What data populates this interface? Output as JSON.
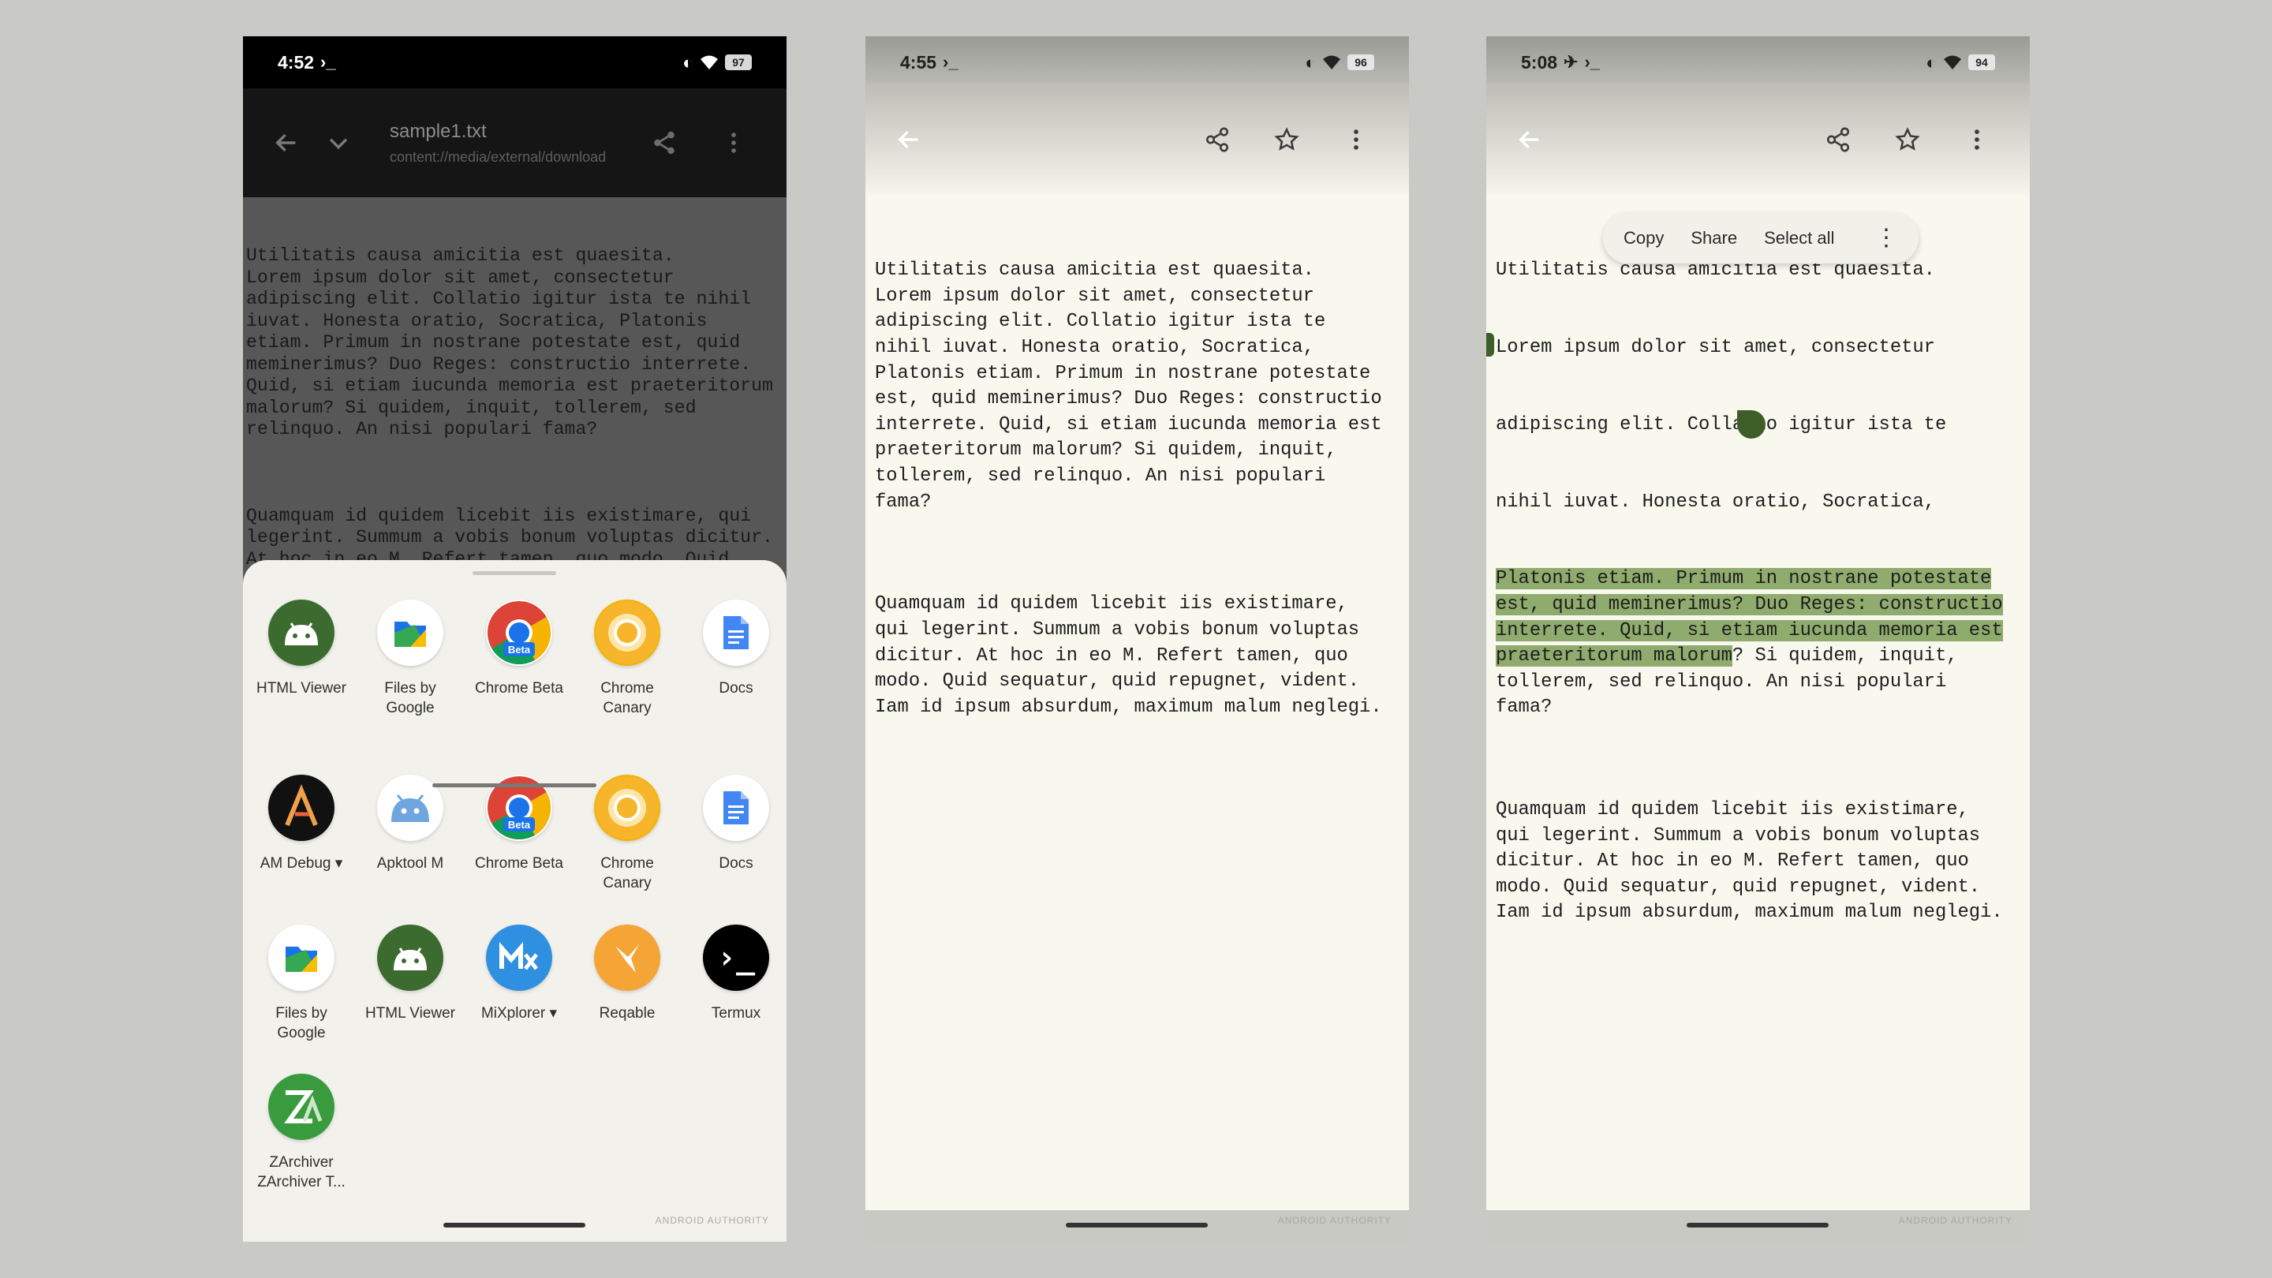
{
  "accent": "#8fab6d",
  "panel1": {
    "status": {
      "time": "4:52",
      "glyph": "›_",
      "battery": "97"
    },
    "toolbar": {
      "title": "sample1.txt",
      "subtitle": "content://media/external/download",
      "back_icon": "arrow-left",
      "dropdown_icon": "chevron-down",
      "share_icon": "share",
      "menu_icon": "more-vert"
    },
    "paragraph1": "Utilitatis causa amicitia est quaesita.\nLorem ipsum dolor sit amet, consectetur\nadipiscing elit. Collatio igitur ista te nihil\niuvat. Honesta oratio, Socratica, Platonis\netiam. Primum in nostrane potestate est, quid\nmeminerimus? Duo Reges: constructio interrete.\nQuid, si etiam iucunda memoria est praeteritorum\nmalorum? Si quidem, inquit, tollerem, sed\nrelinquo. An nisi populari fama?",
    "paragraph2": "Quamquam id quidem licebit iis existimare, qui\nlegerint. Summum a vobis bonum voluptas dicitur.\nAt hoc in eo M. Refert tamen, quo modo. Quid\nsequatur, quid repugnet, vident. Iam id ipsum\nabsurdum, maximum malum neglegi.",
    "apps": [
      {
        "label": "HTML Viewer",
        "icon": "android-icon"
      },
      {
        "label": "Files by\nGoogle",
        "icon": "files-icon"
      },
      {
        "label": "Chrome Beta",
        "icon": "chrome-beta-icon",
        "badge": "Beta"
      },
      {
        "label": "Chrome\nCanary",
        "icon": "chrome-canary-icon"
      },
      {
        "label": "Docs",
        "icon": "docs-icon"
      },
      {
        "label": "AM Debug ▾",
        "icon": "am-debug-icon",
        "glyph": "A"
      },
      {
        "label": "Apktool M",
        "icon": "apktool-icon"
      },
      {
        "label": "Chrome Beta",
        "icon": "chrome-beta-icon",
        "badge": "Beta"
      },
      {
        "label": "Chrome\nCanary",
        "icon": "chrome-canary-icon"
      },
      {
        "label": "Docs",
        "icon": "docs-icon"
      },
      {
        "label": "Files by\nGoogle",
        "icon": "files-icon"
      },
      {
        "label": "HTML Viewer",
        "icon": "android-icon"
      },
      {
        "label": "MiXplorer ▾",
        "icon": "mixplorer-icon"
      },
      {
        "label": "Reqable",
        "icon": "reqable-icon"
      },
      {
        "label": "Termux",
        "icon": "termux-icon",
        "glyph": "›_"
      },
      {
        "label": "ZArchiver\nZArchiver T...",
        "icon": "zarchiver-icon",
        "glyph": "ZA"
      }
    ]
  },
  "panel2": {
    "status": {
      "time": "4:55",
      "glyph": "›_",
      "battery": "96"
    },
    "paragraph1": "Utilitatis causa amicitia est quaesita.\nLorem ipsum dolor sit amet, consectetur\nadipiscing elit. Collatio igitur ista te\nnihil iuvat. Honesta oratio, Socratica,\nPlatonis etiam. Primum in nostrane potestate\nest, quid meminerimus? Duo Reges: constructio\ninterrete. Quid, si etiam iucunda memoria est\npraeteritorum malorum? Si quidem, inquit,\ntollerem, sed relinquo. An nisi populari\nfama?",
    "paragraph2": "Quamquam id quidem licebit iis existimare,\nqui legerint. Summum a vobis bonum voluptas\ndicitur. At hoc in eo M. Refert tamen, quo\nmodo. Quid sequatur, quid repugnet, vident.\nIam id ipsum absurdum, maximum malum neglegi."
  },
  "panel3": {
    "status": {
      "time": "5:08",
      "glyph": "›_",
      "battery": "94"
    },
    "line1": "Utilitatis causa amicitia est quaesita.",
    "line2": "Lorem ipsum dolor sit amet, consectetur",
    "line3": "adipiscing elit. Collatio igitur ista te",
    "line4": "nihil iuvat. Honesta oratio, Socratica,",
    "selected": "Platonis etiam. Primum in nostrane potestate\nest, quid meminerimus? Duo Reges: constructio\ninterrete. Quid, si etiam iucunda memoria est\npraeteritorum malorum",
    "after_selection": "? Si quidem, inquit,\ntollerem, sed relinquo. An nisi populari\nfama?",
    "paragraph2": "Quamquam id quidem licebit iis existimare,\nqui legerint. Summum a vobis bonum voluptas\ndicitur. At hoc in eo M. Refert tamen, quo\nmodo. Quid sequatur, quid repugnet, vident.\nIam id ipsum absurdum, maximum malum neglegi.",
    "popup": {
      "copy": "Copy",
      "share": "Share",
      "select_all": "Select all"
    }
  },
  "watermark": "ANDROID AUTHORITY"
}
